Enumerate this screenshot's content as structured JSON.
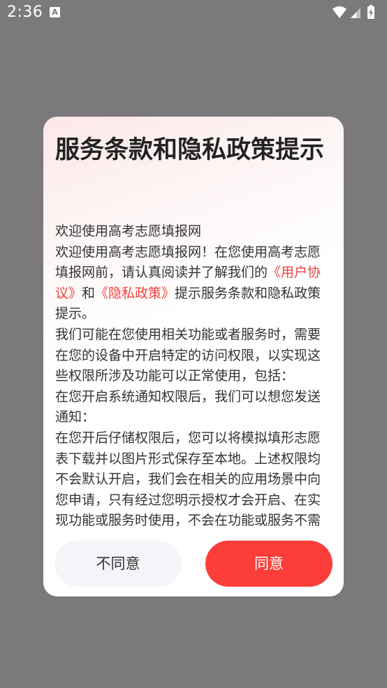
{
  "status_bar": {
    "time": "2:36",
    "notification_icon": "A",
    "icons": [
      "wifi-icon",
      "signal-icon",
      "battery-charging-icon"
    ]
  },
  "dialog": {
    "title": "服务条款和隐私政策提示",
    "intro": "欢迎使用高考志愿填报网",
    "para1_before": "欢迎使用高考志愿填报网！在您使用高考志愿填报网前，请认真阅读并了解我们的",
    "user_agreement_link": "《用户协议》",
    "para1_and": "和",
    "privacy_policy_link": "《隐私政策》",
    "para1_after": "提示服务条款和隐私政策提示。",
    "para2": "我们可能在您使用相关功能或者服务时，需要在您的设备中开启特定的访问权限，以实现这些权限所涉及功能可以正常使用，包括：",
    "para3": "在您开启系统通知权限后，我们可以想您发送通知：",
    "para4": "在您开后仔储权限后，您可以将模拟填形志愿表下载并以图片形式保存至本地。上述权限均不会默认开启，我们会在相关的应用场景中向您申请，只有经过您明示授权才会开启、在实现功能或服务时使用，不会在功能或服务不需",
    "disagree_label": "不同意",
    "agree_label": "同意"
  },
  "colors": {
    "overlay": "#7b797c",
    "accent": "#fb3e3a",
    "link": "#f43f3b"
  }
}
